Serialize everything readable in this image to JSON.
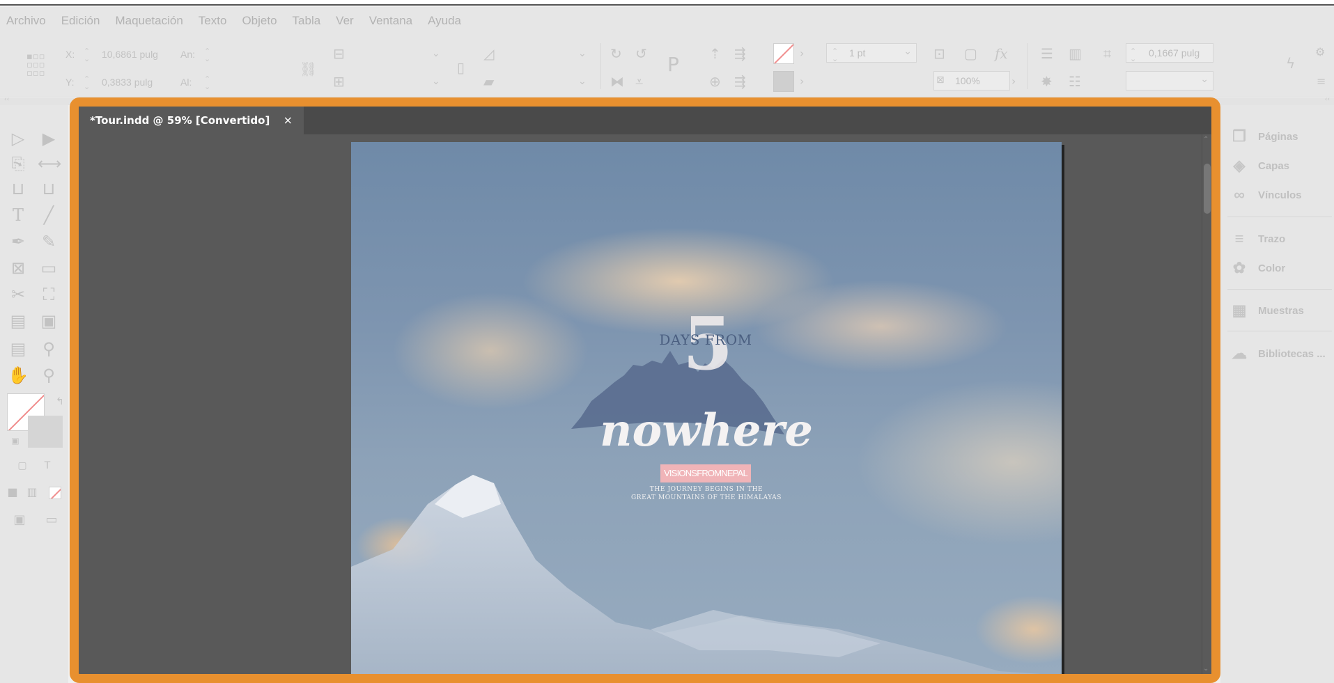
{
  "menubar": {
    "items": [
      "Archivo",
      "Edición",
      "Maquetación",
      "Texto",
      "Objeto",
      "Tabla",
      "Ver",
      "Ventana",
      "Ayuda"
    ]
  },
  "controlbar": {
    "x_label": "X:",
    "x_value": "10,6861 pulg",
    "y_label": "Y:",
    "y_value": "0,3833 pulg",
    "width_label": "An:",
    "height_label": "Al:",
    "stroke_weight": "1 pt",
    "opacity": "100%",
    "gutter_value": "0,1667 pulg"
  },
  "document": {
    "tab_title": "*Tour.indd @ 59% [Convertido]",
    "close_glyph": "×"
  },
  "page_content": {
    "number": "5",
    "days_from": "DAYS FROM",
    "nowhere": "nowhere",
    "pink_label": "VISIONSFROMNEPAL",
    "tagline_1": "THE JOURNEY BEGINS IN THE",
    "tagline_2": "GREAT MOUNTAINS OF THE HIMALAYAS"
  },
  "right_panel": {
    "items": [
      "Páginas",
      "Capas",
      "Vínculos",
      "Trazo",
      "Color",
      "Muestras",
      "Bibliotecas ..."
    ]
  },
  "colors": {
    "frame_highlight": "#e8902f",
    "pasteboard": "#595959",
    "pink_label": "#f0b4b8"
  }
}
